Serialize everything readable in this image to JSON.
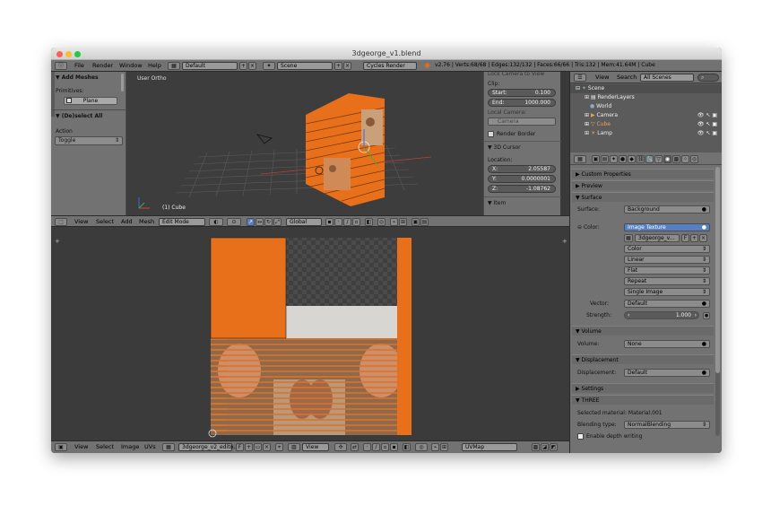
{
  "window": {
    "title": "3dgeorge_v1.blend"
  },
  "topbar": {
    "menus": [
      "File",
      "Render",
      "Window",
      "Help"
    ],
    "screen_layout": "Default",
    "scene": "Scene",
    "engine": "Cycles Render",
    "stats": "v2.76 | Verts:68/68 | Edges:132/132 | Faces:66/66 | Tris:132 | Mem:41.64M | Cube"
  },
  "left_panel": {
    "add_meshes": "Add Meshes",
    "primitives_label": "Primitives:",
    "plane_label": "Plane",
    "deselect_all": "(De)select All",
    "action_label": "Action",
    "action_value": "Toggle"
  },
  "viewport": {
    "view_label": "User Ortho",
    "object_label": "(1) Cube"
  },
  "n_panel": {
    "lock_camera": "Lock Camera to View",
    "clip": "Clip:",
    "start_label": "Start:",
    "start_value": "0.100",
    "end_label": "End:",
    "end_value": "1000.000",
    "local_camera": "Local Camera:",
    "camera": "Camera",
    "render_border": "Render Border",
    "cursor_section": "3D Cursor",
    "location": "Location:",
    "x_label": "X:",
    "x_value": "2.05587",
    "y_label": "Y:",
    "y_value": "0.0000001",
    "z_label": "Z:",
    "z_value": "-1.08762",
    "item_section": "Item"
  },
  "viewport_header": {
    "menus": [
      "View",
      "Select",
      "Add",
      "Mesh"
    ],
    "mode": "Edit Mode",
    "orientation": "Global"
  },
  "uv_header": {
    "menus": [
      "View",
      "Select",
      "Image",
      "UVs"
    ],
    "image_name": "3dgeorge_v2_edito...",
    "fake_user": "F",
    "view": "View",
    "uvmap": "UVMap"
  },
  "outliner": {
    "view": "View",
    "search": "Search",
    "filter": "All Scenes",
    "items": [
      "Scene",
      "RenderLayers",
      "World",
      "Camera",
      "Cube",
      "Lamp"
    ]
  },
  "properties": {
    "custom_properties": "Custom Properties",
    "preview": "Preview",
    "surface_section": "Surface",
    "surface_label": "Surface:",
    "surface_value": "Background",
    "color_label": "Color:",
    "color_value": "Image Texture",
    "image_name": "3dgeorge_v...",
    "fake_user": "F",
    "color_space": "Color",
    "interpolation": "Linear",
    "projection": "Flat",
    "extension": "Repeat",
    "source": "Single Image",
    "vector_label": "Vector:",
    "vector_value": "Default",
    "strength_label": "Strength:",
    "strength_value": "1.000",
    "volume_section": "Volume",
    "volume_label": "Volume:",
    "volume_value": "None",
    "displacement_section": "Displacement",
    "displacement_label": "Displacement:",
    "displacement_value": "Default",
    "settings_section": "Settings",
    "three_section": "THREE",
    "selected_material": "Selected material: Material.001",
    "blending_label": "Blending type:",
    "blending_value": "NormalBlending",
    "depth_writing": "Enable depth writing"
  },
  "colors": {
    "accent_orange": "#e8701a",
    "selected_blue": "#5680c2",
    "panel_gray": "#727272"
  }
}
